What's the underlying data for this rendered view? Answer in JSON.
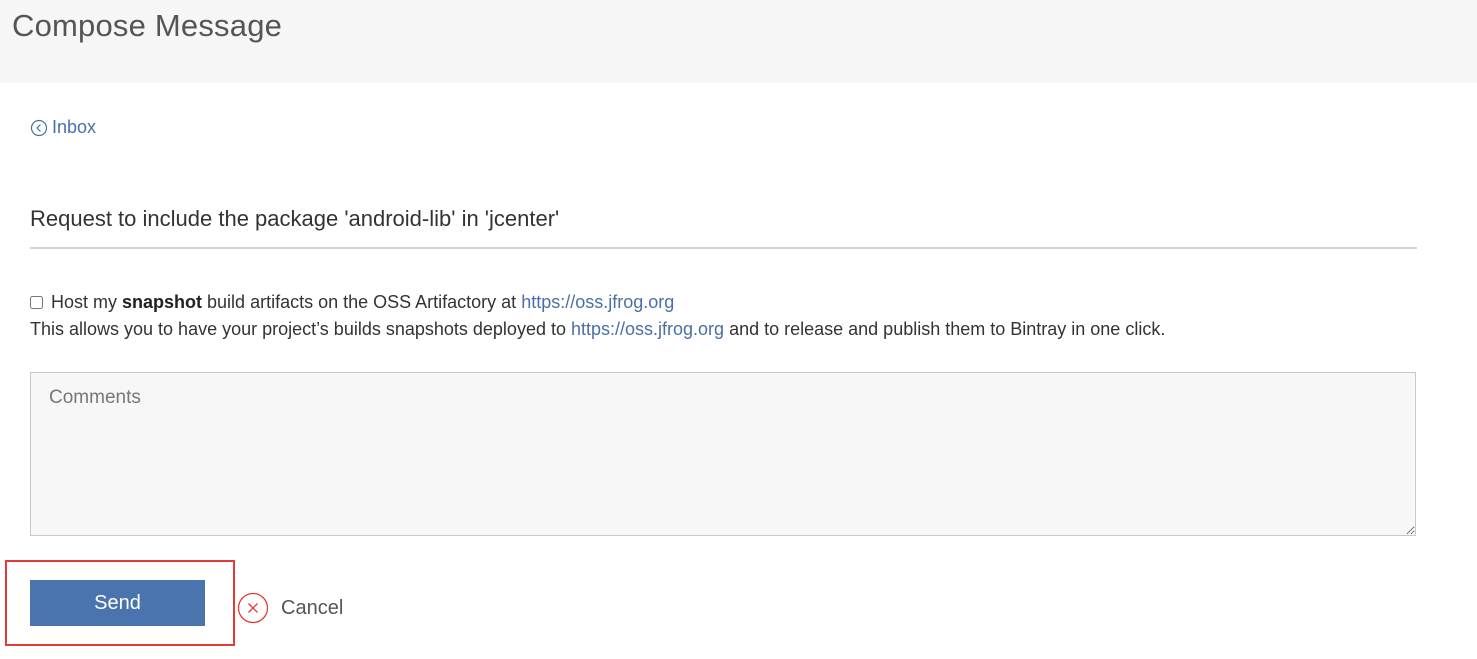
{
  "header": {
    "title": "Compose Message"
  },
  "nav": {
    "back_label": "Inbox",
    "back_icon": "chevron-left-circle-icon"
  },
  "message": {
    "subject": "Request to include the package 'android-lib' in 'jcenter'"
  },
  "snapshot": {
    "checked": false,
    "prefix": "Host my ",
    "bold": "snapshot",
    "middle": " build artifacts on the OSS Artifactory at ",
    "link": "https://oss.jfrog.org"
  },
  "description": {
    "prefix": "This allows you to have your project’s builds snapshots deployed to ",
    "link": "https://oss.jfrog.org",
    "suffix": " and to release and publish them to Bintray in one click."
  },
  "comments": {
    "placeholder": "Comments",
    "value": ""
  },
  "actions": {
    "send_label": "Send",
    "cancel_label": "Cancel",
    "cancel_icon": "close-circle-icon"
  },
  "colors": {
    "accent": "#4a74ae",
    "link": "#4a6fa5",
    "highlight": "#e53935",
    "header_bg": "#f6f6f6"
  }
}
